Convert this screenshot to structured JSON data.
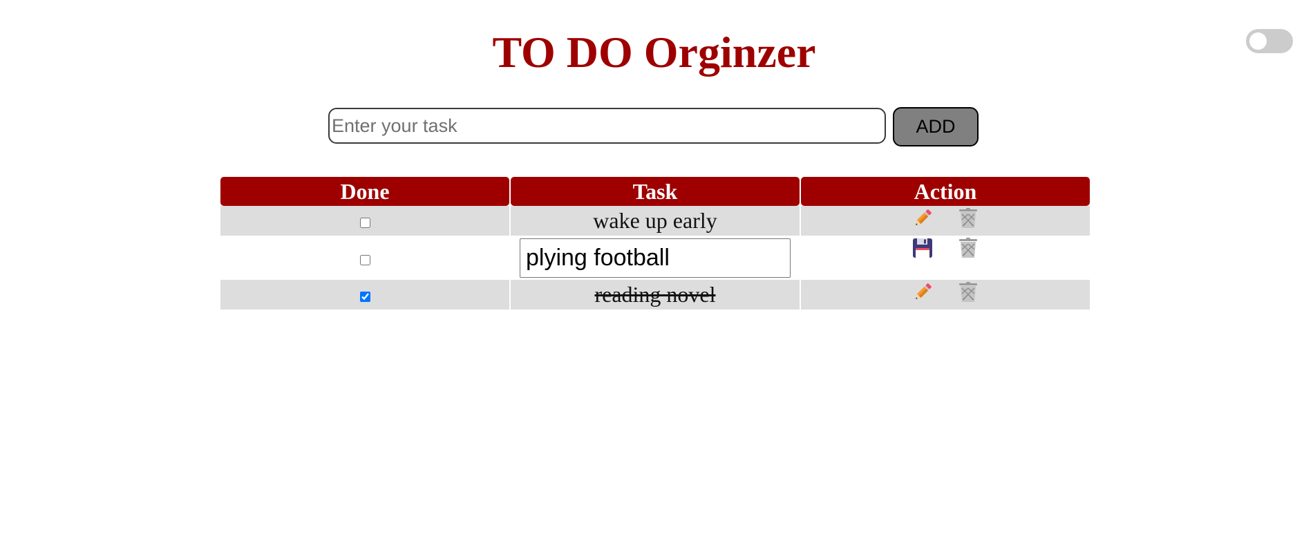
{
  "app": {
    "title": "TO DO Orginzer"
  },
  "theme_toggle": {
    "on": false
  },
  "new_task": {
    "value": "",
    "placeholder": "Enter your task",
    "add_label": "ADD"
  },
  "table": {
    "headers": [
      "Done",
      "Task",
      "Action"
    ],
    "rows": [
      {
        "done": false,
        "task": "wake up early",
        "editing": false,
        "actions": [
          "pencil-icon",
          "trash-icon"
        ]
      },
      {
        "done": false,
        "task": "plying football",
        "editing": true,
        "actions": [
          "floppy-disk-icon",
          "trash-icon"
        ]
      },
      {
        "done": true,
        "task": "reading novel",
        "editing": false,
        "actions": [
          "pencil-icon",
          "trash-icon"
        ]
      }
    ]
  },
  "colors": {
    "accent": "#9e0000",
    "row_alt": "#dddddd",
    "add_button": "#808080",
    "toggle_off": "#cccccc"
  }
}
